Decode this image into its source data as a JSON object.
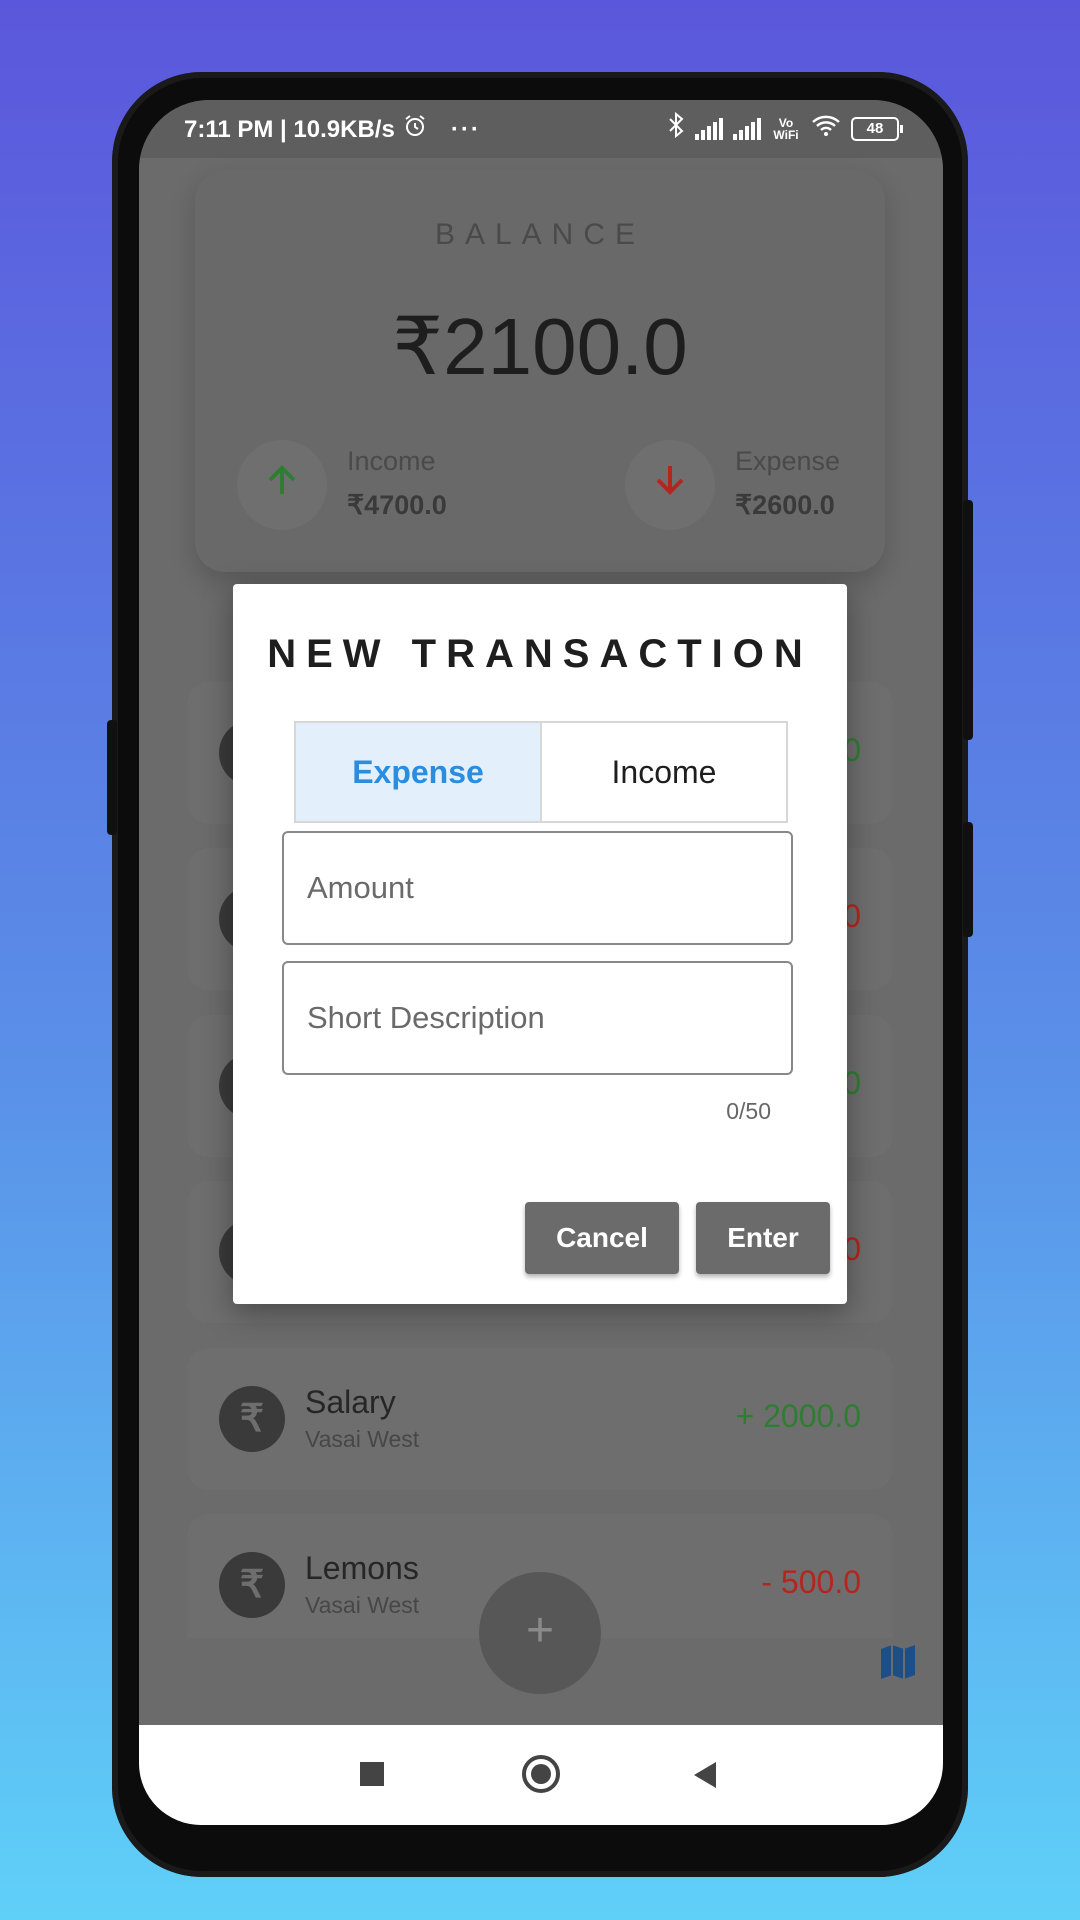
{
  "status_bar": {
    "time_speed": "7:11 PM | 10.9KB/s",
    "dots": "···",
    "battery": "48",
    "wifi_label": "Vo WiFi"
  },
  "balance": {
    "title": "BALANCE",
    "amount": "₹2100.0",
    "income_label": "Income",
    "income_value": "₹4700.0",
    "expense_label": "Expense",
    "expense_value": "₹2600.0"
  },
  "transactions": [
    {
      "title": "",
      "location": "",
      "amount": "0",
      "type": "income"
    },
    {
      "title": "",
      "location": "",
      "amount": "0",
      "type": "expense"
    },
    {
      "title": "",
      "location": "",
      "amount": "0",
      "type": "income"
    },
    {
      "title": "",
      "location": "",
      "amount": "0",
      "type": "expense"
    },
    {
      "title": "Salary",
      "location": "Vasai West",
      "amount": "+ 2000.0",
      "type": "income"
    },
    {
      "title": "Lemons",
      "location": "Vasai West",
      "amount": "- 500.0",
      "type": "expense"
    }
  ],
  "rupee_symbol": "₹",
  "fab_label": "+",
  "dialog": {
    "title": "NEW TRANSACTION",
    "tab_expense": "Expense",
    "tab_income": "Income",
    "selected_tab": "Expense",
    "amount_placeholder": "Amount",
    "description_placeholder": "Short Description",
    "char_counter": "0/50",
    "cancel_label": "Cancel",
    "enter_label": "Enter"
  },
  "colors": {
    "income": "#2f7d32",
    "expense": "#b3261e",
    "accent": "#2b8de0"
  },
  "icons": {
    "income": "arrow-up-icon",
    "expense": "arrow-down-icon",
    "map": "map-icon"
  }
}
